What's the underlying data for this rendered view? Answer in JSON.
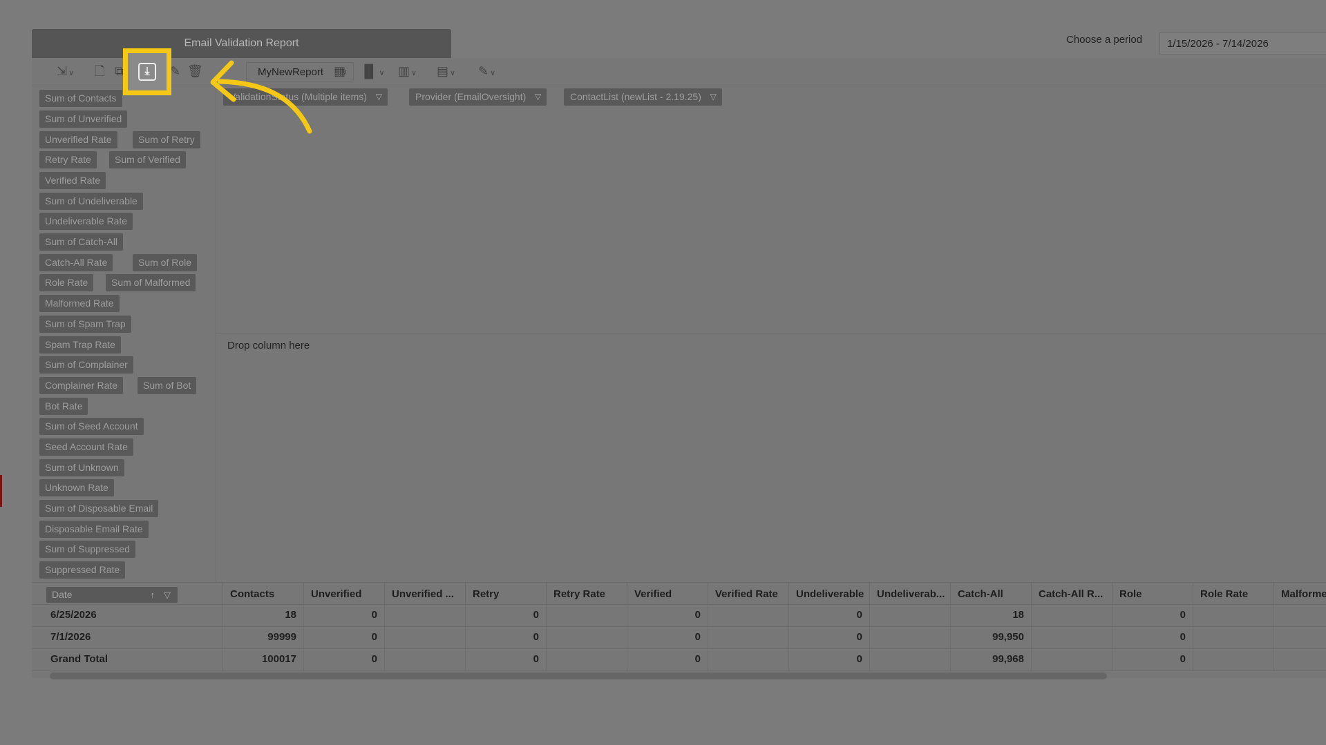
{
  "report": {
    "title": "Email Validation Report"
  },
  "period": {
    "label": "Choose a period",
    "value": "1/15/2026 - 7/14/2026"
  },
  "toolbar": {
    "report_name": "MyNewReport",
    "icons": [
      "export-icon",
      "new-report-icon",
      "copy-icon",
      "save-icon",
      "edit-icon",
      "delete-icon",
      "grid-icon",
      "chart-icon",
      "layout-icon",
      "data-icon",
      "pencil-icon"
    ],
    "highlight_color": "#f5c816"
  },
  "fields": [
    "Sum of Contacts",
    "Sum of Unverified",
    "Unverified Rate",
    "Sum of Retry",
    "Retry Rate",
    "Sum of Verified",
    "Verified Rate",
    "Sum of Undeliverable",
    "Undeliverable Rate",
    "Sum of Catch-All",
    "Catch-All Rate",
    "Sum of Role",
    "Role Rate",
    "Sum of Malformed",
    "Malformed Rate",
    "Sum of Spam Trap",
    "Spam Trap Rate",
    "Sum of Complainer",
    "Complainer Rate",
    "Sum of Bot",
    "Bot Rate",
    "Sum of Seed Account",
    "Seed Account Rate",
    "Sum of Unknown",
    "Unknown Rate",
    "Sum of Disposable Email",
    "Disposable Email Rate",
    "Sum of Suppressed",
    "Suppressed Rate"
  ],
  "filters": [
    "ValidationStatus (Multiple items)",
    "Provider (EmailOversight)",
    "ContactList (newList - 2.19.25)"
  ],
  "drop_zone": {
    "text": "Drop column here"
  },
  "table": {
    "row_field": "Date",
    "columns": [
      "Contacts",
      "Unverified",
      "Unverified ...",
      "Retry",
      "Retry Rate",
      "Verified",
      "Verified Rate",
      "Undeliverable",
      "Undeliverab...",
      "Catch-All",
      "Catch-All R...",
      "Role",
      "Role Rate",
      "Malforme"
    ],
    "rows": [
      {
        "label": "6/25/2026",
        "values": [
          "18",
          "0",
          "",
          "0",
          "",
          "0",
          "",
          "0",
          "",
          "18",
          "",
          "0",
          "",
          ""
        ]
      },
      {
        "label": "7/1/2026",
        "values": [
          "99999",
          "0",
          "",
          "0",
          "",
          "0",
          "",
          "0",
          "",
          "99,950",
          "",
          "0",
          "",
          ""
        ]
      },
      {
        "label": "Grand Total",
        "values": [
          "100017",
          "0",
          "",
          "0",
          "",
          "0",
          "",
          "0",
          "",
          "99,968",
          "",
          "0",
          "",
          ""
        ]
      }
    ]
  }
}
